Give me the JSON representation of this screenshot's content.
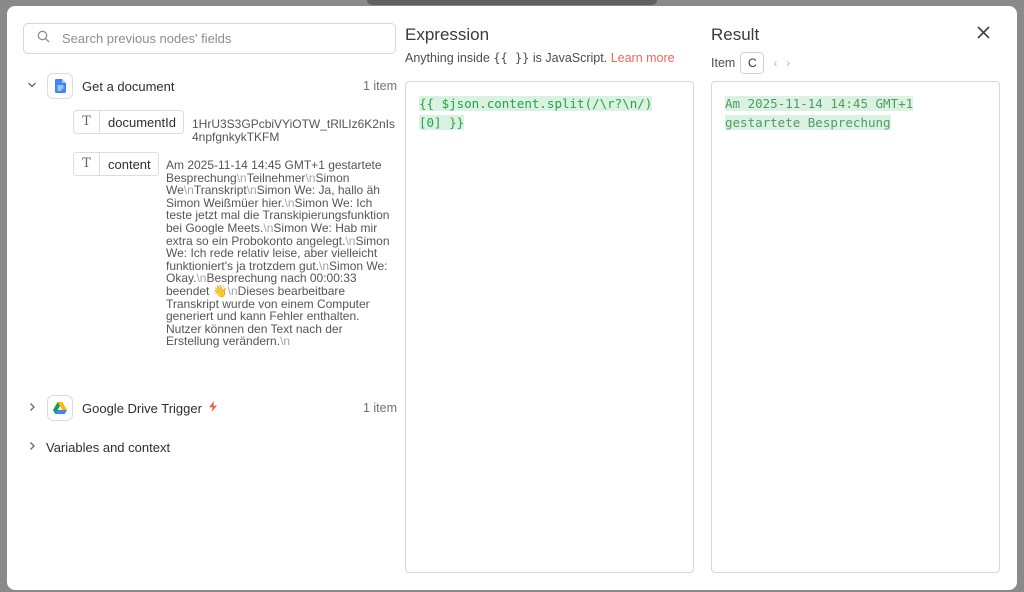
{
  "search": {
    "placeholder": "Search previous nodes' fields"
  },
  "input_tree": {
    "get_document": {
      "name": "Get a document",
      "count": "1 item",
      "fields": {
        "document_id": {
          "label": "documentId",
          "value": "1HrU3S3GPcbiVYiOTW_tRlLIz6K2nIs4npfgnkykTKFM"
        },
        "content": {
          "label": "content",
          "segments": [
            "Am 2025-11-14 14:45 GMT+1 gestartete Besprechung",
            "Teilnehmer",
            "Simon We",
            "Transkript",
            "Simon We: Ja, hallo äh Simon Weißmüer hier.",
            "Simon We: Ich teste jetzt mal die Transkipierungsfunktion bei Google Meets.",
            "Simon We: Hab mir extra so ein Probokonto angelegt.",
            "Simon We: Ich rede relativ leise, aber vielleicht funktioniert's ja trotzdem gut.",
            "Simon We: Okay.",
            "Besprechung nach 00:00:33 beendet 👋",
            "Dieses bearbeitbare Transkript wurde von einem Computer generiert und kann Fehler enthalten. Nutzer können den Text nach der Erstellung verändern.",
            ""
          ],
          "newline_marker": "\\n"
        }
      }
    },
    "drive_trigger": {
      "name": "Google Drive Trigger",
      "count": "1 item"
    },
    "variables": {
      "name": "Variables and context"
    }
  },
  "expression": {
    "title": "Expression",
    "hint_prefix": "Anything inside",
    "hint_braces": "{{ }}",
    "hint_suffix": "is JavaScript.",
    "learn_more": "Learn more",
    "code_line1": "{{ $json.content.split(/\\r?\\n/)",
    "code_line2": "[0] }}"
  },
  "result": {
    "title": "Result",
    "item_label": "Item",
    "item_value": "C",
    "prev": "‹",
    "next": "›",
    "line1": "Am 2025-11-14 14:45 GMT+1 ",
    "line2": "gestartete Besprechung"
  },
  "icons": {
    "close": "close-icon",
    "search": "search-icon",
    "doc": "google-docs-icon",
    "drive": "google-drive-icon",
    "lightning": "lightning-icon"
  },
  "colors": {
    "accent": "#ea6b59",
    "code_green": "#25a546",
    "highlight_bg": "#dbf1e1",
    "docs_blue": "#4285f4"
  }
}
